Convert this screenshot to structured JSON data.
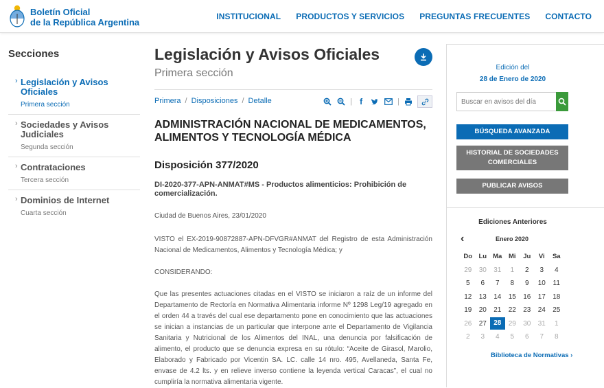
{
  "header": {
    "brand_line1": "Boletín Oficial",
    "brand_line2": "de la República Argentina",
    "nav": [
      "INSTITUCIONAL",
      "PRODUCTOS Y SERVICIOS",
      "PREGUNTAS FRECUENTES",
      "CONTACTO"
    ]
  },
  "sidebar": {
    "title": "Secciones",
    "items": [
      {
        "label": "Legislación y Avisos Oficiales",
        "sub": "Primera sección"
      },
      {
        "label": "Sociedades y Avisos Judiciales",
        "sub": "Segunda sección"
      },
      {
        "label": "Contrataciones",
        "sub": "Tercera sección"
      },
      {
        "label": "Dominios de Internet",
        "sub": "Cuarta sección"
      }
    ]
  },
  "main": {
    "title": "Legislación y Avisos Oficiales",
    "subtitle": "Primera sección",
    "breadcrumb": [
      "Primera",
      "Disposiciones",
      "Detalle"
    ],
    "organization": "ADMINISTRACIÓN NACIONAL DE MEDICAMENTOS, ALIMENTOS Y TECNOLOGÍA MÉDICA",
    "disposition": "Disposición 377/2020",
    "reference": "DI-2020-377-APN-ANMAT#MS - Productos alimenticios: Prohibición de comercialización.",
    "place_date": "Ciudad de Buenos Aires, 23/01/2020",
    "visto": "VISTO el EX-2019-90872887-APN-DFVGR#ANMAT del Registro de esta Administración Nacional de Medicamentos, Alimentos y Tecnología Médica; y",
    "considerando": "CONSIDERANDO:",
    "body": "Que las presentes actuaciones citadas en el VISTO se iniciaron a raíz de un informe del Departamento de Rectoría en Normativa Alimentaria informe Nº 1298 Leg/19 agregado en el orden 44 a través del cual ese departamento pone en conocimiento que las actuaciones se inician a instancias de un particular que interpone ante el Departamento de Vigilancia Sanitaria y Nutricional de los Alimentos del INAL, una denuncia por falsificación de alimento, el producto que se denuncia expresa en su rótulo: “Aceite de Girasol, Marolio, Elaborado y Fabricado por Vicentin SA. LC. calle 14 nro. 495, Avellaneda, Santa Fe, envase de 4.2 lts. y en relieve inverso contiene la leyenda vertical Caracas”, el cual no cumpliría la normativa alimentaria vigente."
  },
  "right": {
    "edition_label": "Edición del",
    "edition_date": "28 de Enero de 2020",
    "search_placeholder": "Buscar en avisos del día",
    "btn_advanced": "BÚSQUEDA AVANZADA",
    "btn_history": "HISTORIAL DE SOCIEDADES COMERCIALES",
    "btn_publish": "PUBLICAR AVISOS",
    "previous_editions": "Ediciones Anteriores",
    "calendar_month": "Enero 2020",
    "weekdays": [
      "Do",
      "Lu",
      "Ma",
      "Mi",
      "Ju",
      "Vi",
      "Sa"
    ],
    "weeks": [
      [
        "29",
        "30",
        "31",
        "1",
        "2",
        "3",
        "4"
      ],
      [
        "5",
        "6",
        "7",
        "8",
        "9",
        "10",
        "11"
      ],
      [
        "12",
        "13",
        "14",
        "15",
        "16",
        "17",
        "18"
      ],
      [
        "19",
        "20",
        "21",
        "22",
        "23",
        "24",
        "25"
      ],
      [
        "26",
        "27",
        "28",
        "29",
        "30",
        "31",
        "1"
      ],
      [
        "2",
        "3",
        "4",
        "5",
        "6",
        "7",
        "8"
      ]
    ],
    "library_link": "Biblioteca de Normativas"
  },
  "colors": {
    "brand": "#0b6cb5",
    "search_green": "#3a9a3a",
    "gray_button": "#777777"
  }
}
